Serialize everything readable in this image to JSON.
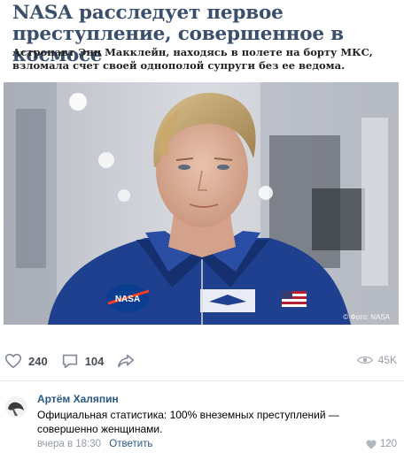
{
  "article": {
    "title": "NASA расследует первое преступление, совершенное в космосе",
    "lead": "Астронавт Энн Макклейн, находясь в полете на борту МКС, взломала счет своей однополой супруги без ее ведома.",
    "photo_credit": "© Фото: NASA",
    "patch_text": "NASA"
  },
  "actions": {
    "likes": "240",
    "comments": "104",
    "views": "45K"
  },
  "comment": {
    "author": "Артём Халяпин",
    "text": "Официальная статистика: 100% внеземных преступлений — совершенно женщинами.",
    "time": "вчера в 18:30",
    "reply_label": "Ответить",
    "likes": "120"
  },
  "colors": {
    "title": "#3a4f6b",
    "link": "#2a5885",
    "muted": "#939aa2",
    "suit_blue": "#1f3f8f"
  }
}
